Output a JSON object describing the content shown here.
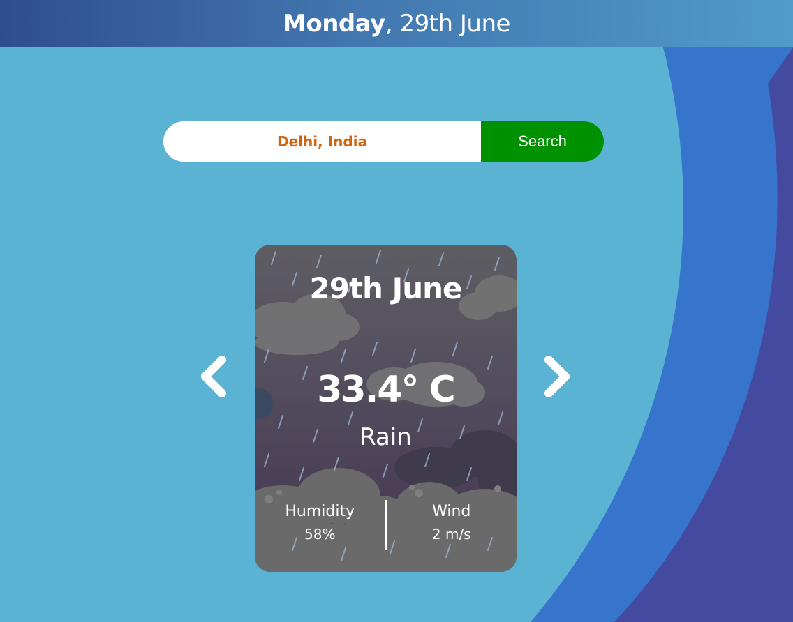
{
  "header": {
    "day": "Monday",
    "separator": ",",
    "date": "29th June"
  },
  "search": {
    "value": "Delhi, India",
    "button_label": "Search"
  },
  "card": {
    "date": "29th June",
    "temperature": "33.4° C",
    "condition": "Rain",
    "humidity_label": "Humidity",
    "humidity_value": "58%",
    "wind_label": "Wind",
    "wind_value": "2 m/s"
  },
  "icons": {
    "prev": "chevron-left-icon",
    "next": "chevron-right-icon"
  },
  "colors": {
    "background": "#5ab3d3",
    "arc_blue": "#3774cc",
    "arc_indigo": "#444aa0",
    "search_button": "#009100",
    "search_text": "#d0650f"
  }
}
